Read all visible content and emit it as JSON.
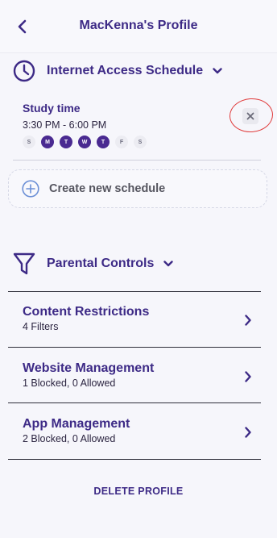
{
  "header": {
    "title": "MacKenna's Profile"
  },
  "schedule_section": {
    "title": "Internet Access Schedule",
    "schedule": {
      "name": "Study time",
      "time": "3:30 PM - 6:00 PM",
      "days": [
        {
          "label": "S",
          "active": false
        },
        {
          "label": "M",
          "active": true
        },
        {
          "label": "T",
          "active": true
        },
        {
          "label": "W",
          "active": true
        },
        {
          "label": "T",
          "active": true
        },
        {
          "label": "F",
          "active": false
        },
        {
          "label": "S",
          "active": false
        }
      ]
    },
    "create_label": "Create new schedule"
  },
  "parental_section": {
    "title": "Parental Controls",
    "items": [
      {
        "title": "Content Restrictions",
        "subtitle": "4 Filters"
      },
      {
        "title": "Website Management",
        "subtitle": "1 Blocked, 0 Allowed"
      },
      {
        "title": "App Management",
        "subtitle": "2 Blocked, 0 Allowed"
      }
    ]
  },
  "delete_label": "DELETE PROFILE",
  "colors": {
    "accent": "#3d2a86",
    "active_day": "#4a2a91",
    "annotation": "#e03a3a"
  }
}
